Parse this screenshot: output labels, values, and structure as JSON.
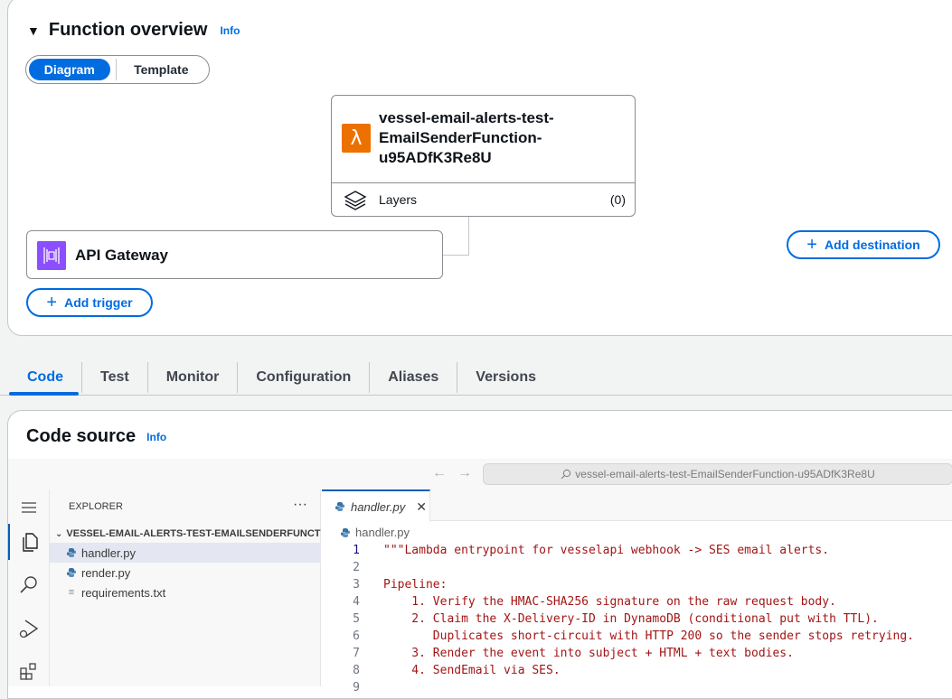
{
  "overview": {
    "title": "Function overview",
    "info_label": "Info",
    "view_toggle": {
      "diagram": "Diagram",
      "template": "Template",
      "selected": "Diagram"
    },
    "function": {
      "name_lines": [
        "vessel-email-alerts-test-",
        "EmailSenderFunction-",
        "u95ADfK3Re8U"
      ],
      "layers_label": "Layers",
      "layers_count": "(0)"
    },
    "trigger": {
      "name": "API Gateway"
    },
    "add_trigger_label": "Add trigger",
    "add_destination_label": "Add destination"
  },
  "tabs": {
    "items": [
      "Code",
      "Test",
      "Monitor",
      "Configuration",
      "Aliases",
      "Versions"
    ],
    "active": "Code"
  },
  "code_source": {
    "title": "Code source",
    "info_label": "Info"
  },
  "ide": {
    "search_text": "vessel-email-alerts-test-EmailSenderFunction-u95ADfK3Re8U",
    "explorer": {
      "header": "EXPLORER",
      "folder": "VESSEL-EMAIL-ALERTS-TEST-EMAILSENDERFUNCTI...",
      "files": [
        "handler.py",
        "render.py",
        "requirements.txt"
      ],
      "selected_file": "handler.py"
    },
    "editor": {
      "tab_label": "handler.py",
      "breadcrumb": "handler.py",
      "current_line": 1,
      "lines": [
        {
          "n": "1",
          "text": "\"\"\"Lambda entrypoint for vesselapi webhook -> SES email alerts."
        },
        {
          "n": "2",
          "text": ""
        },
        {
          "n": "3",
          "text": "Pipeline:"
        },
        {
          "n": "4",
          "text": "    1. Verify the HMAC-SHA256 signature on the raw request body."
        },
        {
          "n": "5",
          "text": "    2. Claim the X-Delivery-ID in DynamoDB (conditional put with TTL)."
        },
        {
          "n": "6",
          "text": "       Duplicates short-circuit with HTTP 200 so the sender stops retrying."
        },
        {
          "n": "7",
          "text": "    3. Render the event into subject + HTML + text bodies."
        },
        {
          "n": "8",
          "text": "    4. SendEmail via SES."
        },
        {
          "n": "9",
          "text": ""
        }
      ]
    }
  },
  "colors": {
    "accent": "#006ce0",
    "lambda_orange": "#ed7100",
    "api_gateway_purple": "#8c4fff",
    "code_string": "#a31515"
  }
}
